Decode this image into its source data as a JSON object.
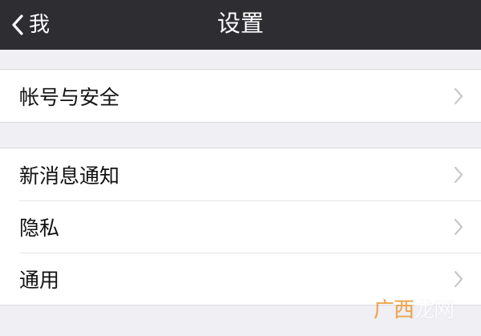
{
  "nav": {
    "back_label": "我",
    "title": "设置"
  },
  "groups": [
    {
      "items": [
        {
          "label": "帐号与安全"
        }
      ]
    },
    {
      "items": [
        {
          "label": "新消息通知"
        },
        {
          "label": "隐私"
        },
        {
          "label": "通用"
        }
      ]
    }
  ],
  "icons": {
    "back": "chevron-left-icon",
    "row_arrow": "chevron-right-icon"
  },
  "colors": {
    "nav_bg": "#2e2d32",
    "page_bg": "#efeff4",
    "row_bg": "#ffffff",
    "chevron": "#c7c7cc"
  },
  "watermark": {
    "text_part1": "广西",
    "text_part2": "龙网"
  }
}
